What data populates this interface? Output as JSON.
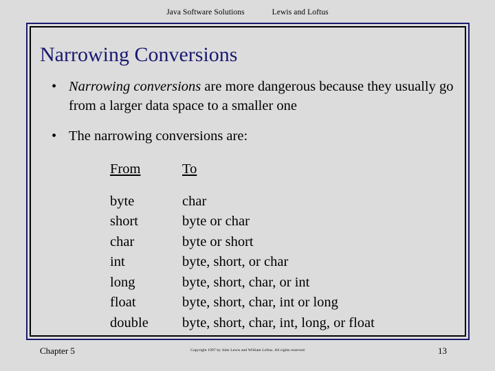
{
  "header": {
    "book_title": "Java Software Solutions",
    "authors": "Lewis and Loftus"
  },
  "slide": {
    "title": "Narrowing Conversions",
    "title_color": "#191970",
    "background_color": "#dcdcdc",
    "frame_outer_color": "#191970",
    "frame_inner_color": "#000000",
    "bullet_glyph": "•",
    "bullets": [
      {
        "emphasis": "Narrowing conversions",
        "rest": " are more dangerous because they usually go from a larger data space to a smaller one"
      },
      {
        "emphasis": "",
        "rest": "The narrowing conversions are:"
      }
    ],
    "table": {
      "headers": {
        "from": "From",
        "to": "To"
      },
      "rows": [
        {
          "from": "byte",
          "to": "char"
        },
        {
          "from": "short",
          "to": "byte or char"
        },
        {
          "from": "char",
          "to": "byte or short"
        },
        {
          "from": "int",
          "to": "byte, short, or char"
        },
        {
          "from": "long",
          "to": "byte, short, char, or int"
        },
        {
          "from": "float",
          "to": "byte, short, char, int or long"
        },
        {
          "from": "double",
          "to": "byte, short, char, int, long, or float"
        }
      ]
    }
  },
  "footer": {
    "chapter": "Chapter 5",
    "copyright": "Copyright 1997 by John Lewis and William Loftus.  All rights reserved",
    "page_number": "13"
  }
}
